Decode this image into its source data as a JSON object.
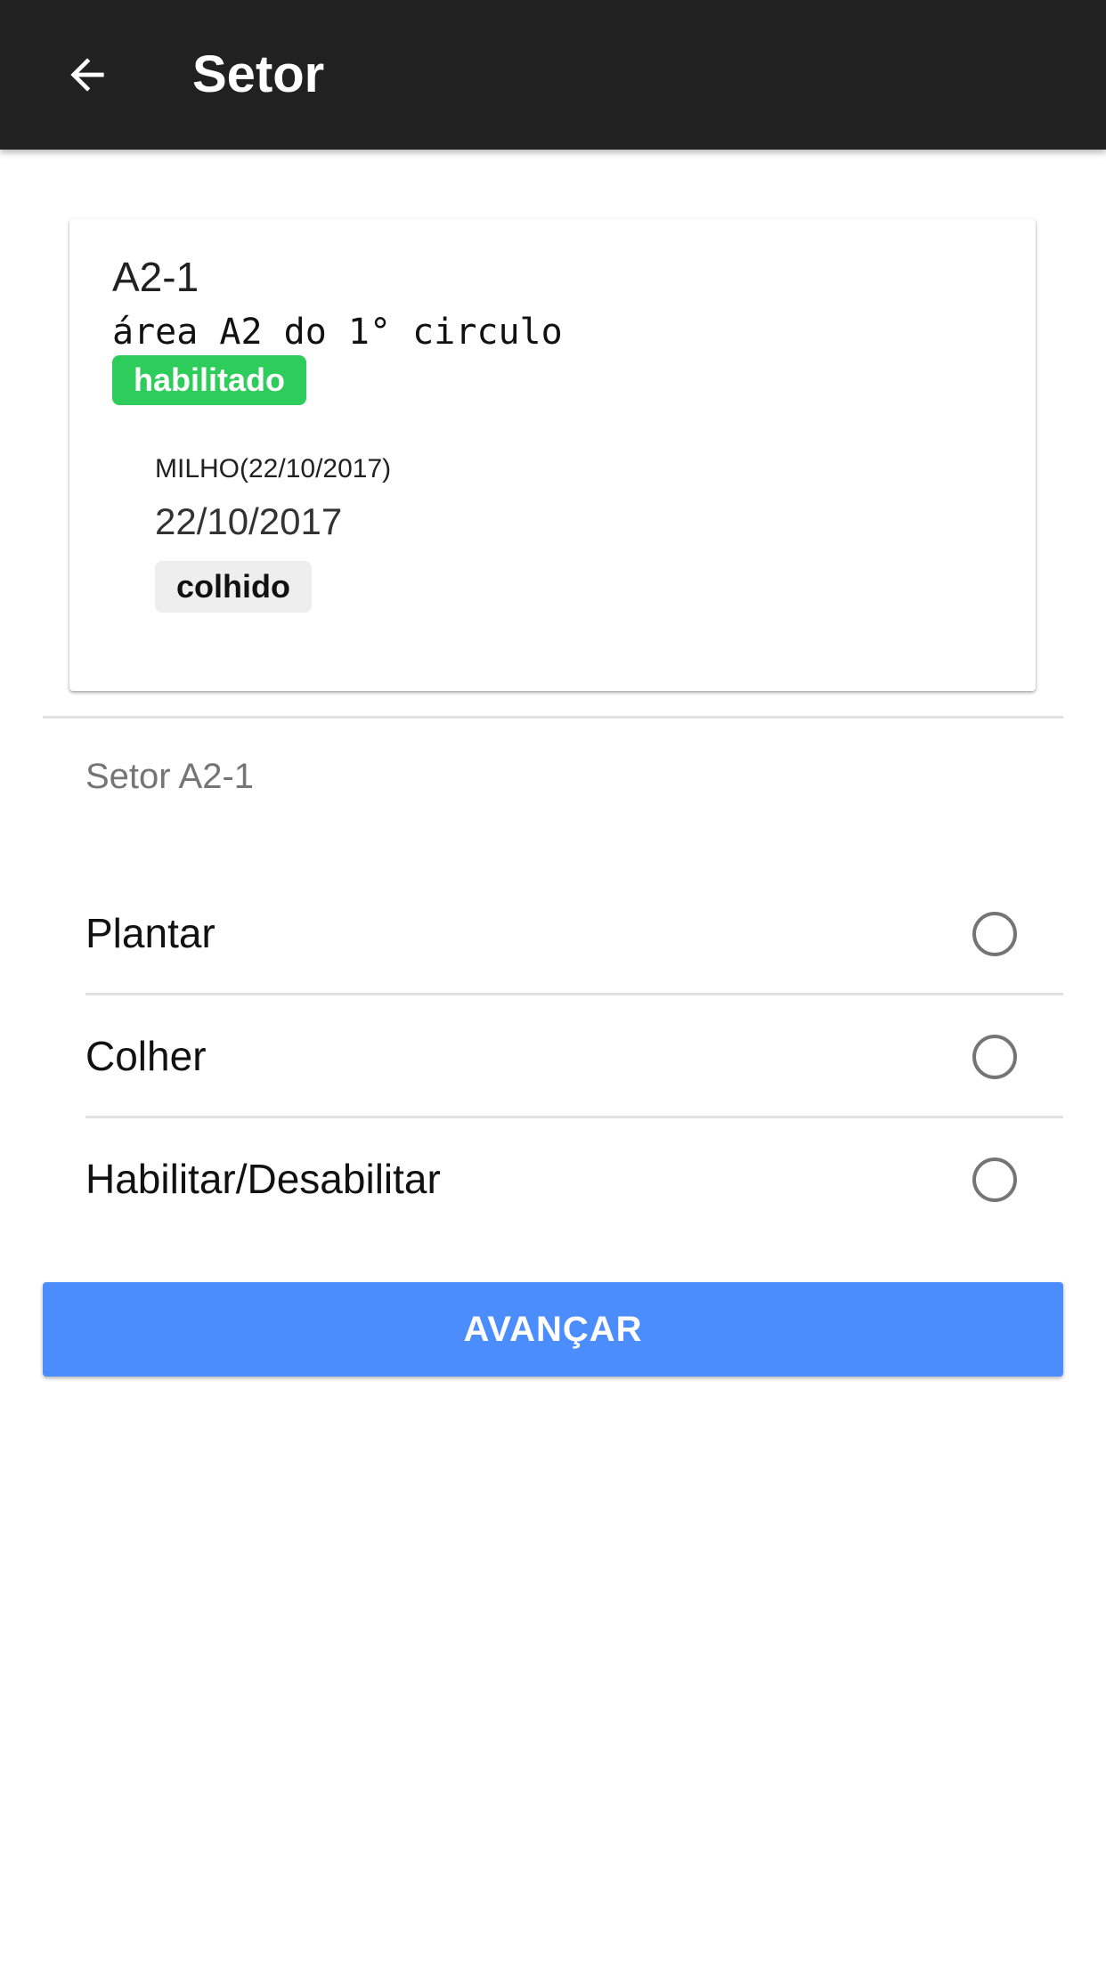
{
  "appbar": {
    "back_icon": "arrow-left-icon",
    "title": "Setor"
  },
  "card": {
    "title": "A2-1",
    "description": "área A2 do 1° circulo",
    "status_badge": "habilitado",
    "status_color": "#2ecc5b",
    "crop": {
      "name": "MILHO(22/10/2017)",
      "date": "22/10/2017",
      "status": "colhido"
    }
  },
  "section": {
    "label": "Setor A2-1"
  },
  "options": [
    {
      "label": "Plantar",
      "selected": false
    },
    {
      "label": "Colher",
      "selected": false
    },
    {
      "label": "Habilitar/Desabilitar",
      "selected": false
    }
  ],
  "advance_button": {
    "label": "AVANÇAR",
    "color": "#4b8dfc"
  }
}
